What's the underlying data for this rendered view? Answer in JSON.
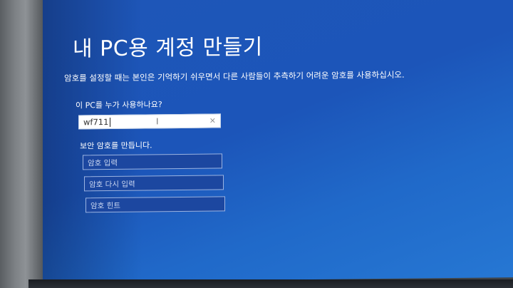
{
  "page": {
    "title": "내 PC용 계정 만들기",
    "description": "암호를 설정할 때는 본인은 기억하기 쉬우면서 다른 사람들이 추측하기 어려운 암호를 사용하십시오."
  },
  "user": {
    "question": "이 PC를 누가 사용하나요?",
    "value": "wf711",
    "clear_icon": "close-icon",
    "clear_glyph": "×",
    "cursor_icon": "text-cursor-icon",
    "cursor_glyph": "I"
  },
  "password": {
    "heading": "보안 암호를 만듭니다.",
    "fields": [
      {
        "placeholder": "암호 입력"
      },
      {
        "placeholder": "암호 다시 입력"
      },
      {
        "placeholder": "암호 힌트"
      }
    ]
  },
  "colors": {
    "screen_background": "#1c55b9",
    "field_background": "#1c47a0",
    "text": "#ffffff"
  }
}
